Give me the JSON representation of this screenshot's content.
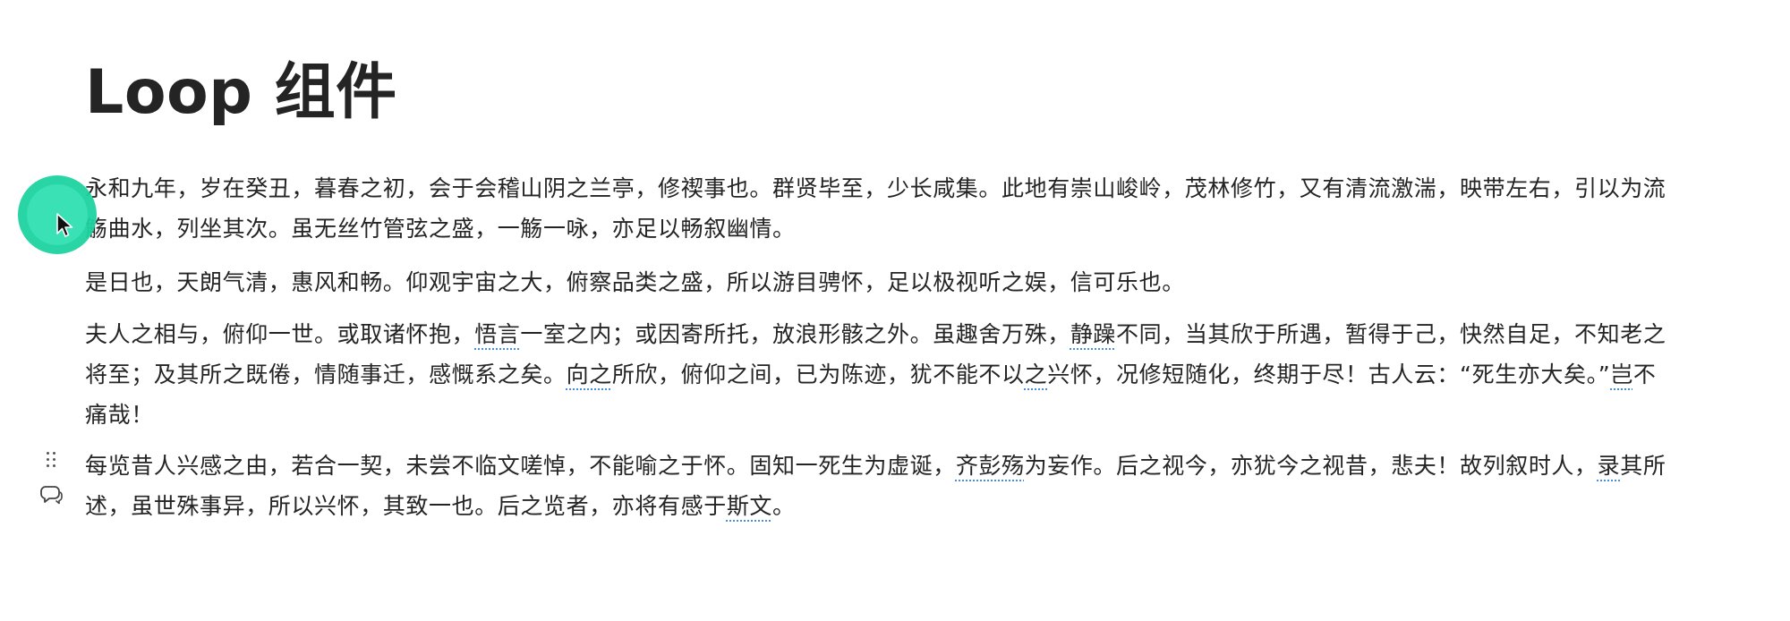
{
  "document": {
    "title": "Loop 组件",
    "paragraphs": {
      "p1": "永和九年，岁在癸丑，暮春之初，会于会稽山阴之兰亭，修禊事也。群贤毕至，少长咸集。此地有崇山峻岭，茂林修竹，又有清流激湍，映带左右，引以为流觞曲水，列坐其次。虽无丝竹管弦之盛，一觞一咏，亦足以畅叙幽情。",
      "p2": "是日也，天朗气清，惠风和畅。仰观宇宙之大，俯察品类之盛，所以游目骋怀，足以极视听之娱，信可乐也。",
      "p3": {
        "a": "夫人之相与，俯仰一世。或取诸怀抱，",
        "b": "悟言",
        "c": "一室之内；或因寄所托，放浪形骸之外。虽趣舍万殊，",
        "d": "静躁",
        "e": "不同，当其欣于所遇，暂得于己，快然自足，不知老之将至；及其所之既倦，情随事迁，感慨系之矣。",
        "f": "向之",
        "g": "所欣，俯仰之间，已为陈迹，犹不能不以",
        "h": "之",
        "i": "兴怀，况修短随化，终期于尽！古人云：“死生亦大矣。”",
        "j": "岂",
        "k": "不痛哉！"
      },
      "p4": {
        "a": "每览昔人兴感之由，若合一契，未尝不临文嗟悼，不能喻之于怀。固知一死生为虚诞，",
        "b": "齐彭殇",
        "c": "为妄作。后之视今，亦犹今之视昔，悲夫！故列叙时人，",
        "d": "录",
        "e": "其所述，虽世殊事异，所以兴怀，其致一也。后之览者，亦将有感于",
        "f": "斯文",
        "g": "。"
      }
    }
  },
  "icons": {
    "drag_handle": "drag-handle-icon",
    "comment": "comment-icon",
    "cursor": "mouse-pointer-icon"
  },
  "colors": {
    "text": "#242424",
    "spellcheck_underline": "#4a90d9",
    "cursor_highlight": "#1ed3a0"
  }
}
